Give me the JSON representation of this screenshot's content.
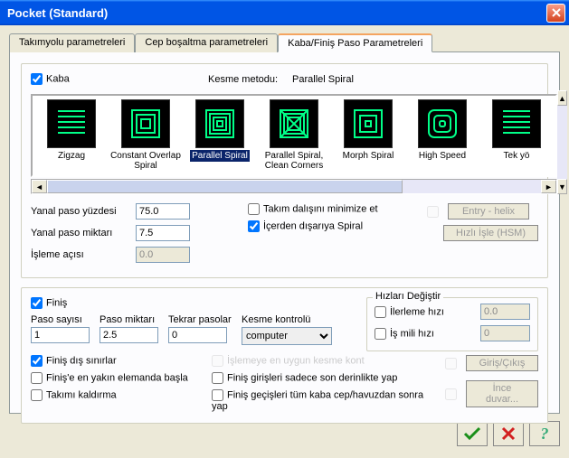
{
  "window": {
    "title": "Pocket  (Standard)"
  },
  "tabs": {
    "items": [
      {
        "label": "Takımyolu parametreleri"
      },
      {
        "label": "Cep boşaltma parametreleri"
      },
      {
        "label": "Kaba/Finiş Paso Parametreleri"
      }
    ],
    "active": 2
  },
  "kaba": {
    "label": "Kaba",
    "kesme_metodu_label": "Kesme metodu:",
    "kesme_metodu_value": "Parallel Spiral",
    "strip": [
      {
        "label": "Zigzag"
      },
      {
        "label": "Constant Overlap Spiral"
      },
      {
        "label": "Parallel Spiral"
      },
      {
        "label": "Parallel Spiral, Clean Corners"
      },
      {
        "label": "Morph Spiral"
      },
      {
        "label": "High Speed"
      },
      {
        "label": "Tek yö"
      }
    ],
    "yanal_paso_yuzdesi_label": "Yanal paso yüzdesi",
    "yanal_paso_yuzdesi_value": "75.0",
    "yanal_paso_miktari_label": "Yanal paso miktarı",
    "yanal_paso_miktari_value": "7.5",
    "isleme_acisi_label": "İşleme açısı",
    "isleme_acisi_value": "0.0",
    "minimize_label": "Takım dalışını minimize et",
    "icerden_label": "İçerden dışarıya Spiral",
    "entry_helix_label": "Entry - helix",
    "hizli_isle_label": "Hızlı İşle (HSM)"
  },
  "finis": {
    "label": "Finiş",
    "paso_sayisi_label": "Paso sayısı",
    "paso_sayisi_value": "1",
    "paso_miktari_label": "Paso miktarı",
    "paso_miktari_value": "2.5",
    "tekrar_label": "Tekrar pasolar",
    "tekrar_value": "0",
    "kesme_kontrolu_label": "Kesme kontrolü",
    "kesme_kontrolu_value": "computer",
    "finis_dis_label": "Finiş dış sınırlar",
    "finis_en_yakin_label": "Finiş'e en yakın elemanda başla",
    "takimi_kaldirma_label": "Takımı kaldırma",
    "isleme_uygun_label": "İşlemeye en uygun kesme kont",
    "finis_girisleri_label": "Finiş girişleri sadece son derinlikte yap",
    "finis_gecisleri_label": "Finiş geçişleri tüm kaba cep/havuzdan sonra yap",
    "hizlari_degistir_label": "Hızları Değiştir",
    "ilerleme_label": "İlerleme hızı",
    "ilerleme_value": "0.0",
    "is_mili_label": "İş mili hızı",
    "is_mili_value": "0",
    "giris_cikis_label": "Giriş/Çıkış",
    "ince_duvar_label": "İnce duvar..."
  }
}
